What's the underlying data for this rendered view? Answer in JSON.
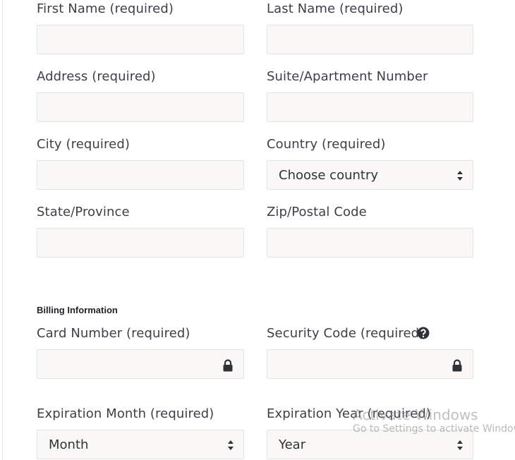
{
  "form": {
    "first_name_label": "First Name (required)",
    "last_name_label": "Last Name (required)",
    "address_label": "Address (required)",
    "suite_label": "Suite/Apartment Number",
    "city_label": "City (required)",
    "country_label": "Country (required)",
    "country_value": "Choose country",
    "state_label": "State/Province",
    "zip_label": "Zip/Postal Code"
  },
  "billing": {
    "heading": "Billing Information",
    "card_number_label": "Card Number (required)",
    "security_code_label": "Security Code (required)",
    "exp_month_label": "Expiration Month (required)",
    "exp_month_value": "Month",
    "exp_year_label": "Expiration Year (required)",
    "exp_year_value": "Year"
  },
  "watermark": {
    "line1": "Activate Windows",
    "line2": "Go to Settings to activate Windows."
  }
}
